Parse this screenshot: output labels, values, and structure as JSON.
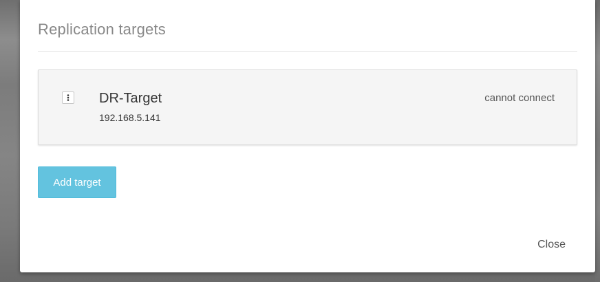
{
  "dialog": {
    "title": "Replication targets"
  },
  "targets": [
    {
      "name": "DR-Target",
      "address": "192.168.5.141",
      "status": "cannot connect",
      "menu_icon": "vertical-ellipsis-icon"
    }
  ],
  "actions": {
    "add_target_label": "Add target",
    "close_label": "Close"
  },
  "colors": {
    "primary_button": "#5bc0de",
    "card_background": "#f5f5f5",
    "title_text": "#888888"
  }
}
